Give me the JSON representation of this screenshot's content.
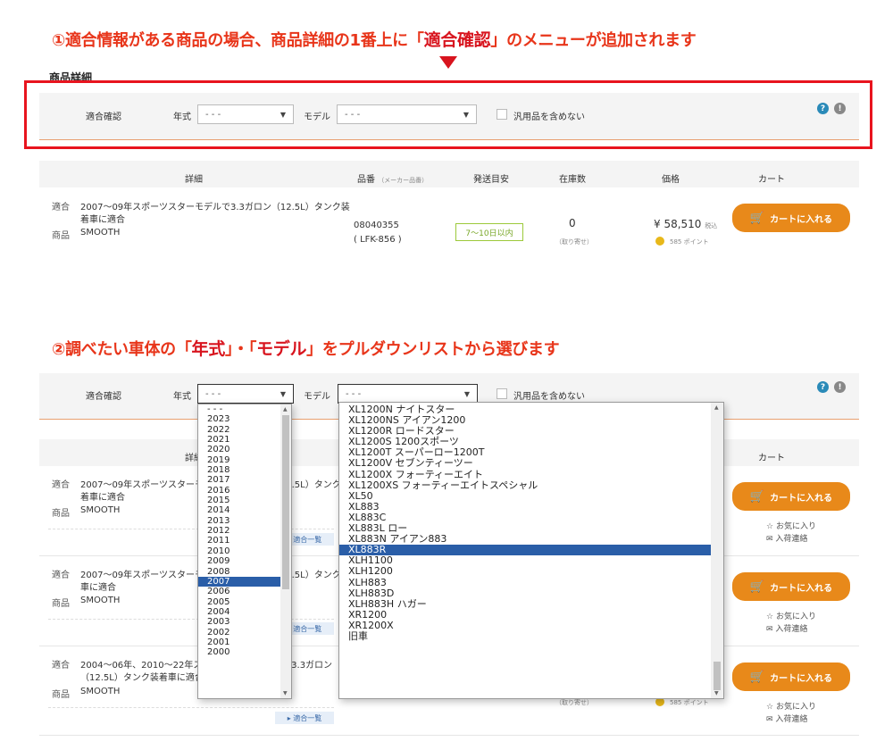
{
  "captions": {
    "step1_prefix": "①適合情報がある商品の場合、商品詳細の1番上に「",
    "step1_highlight": "適合確認",
    "step1_suffix": "」のメニューが追加されます",
    "step2_prefix": "②調べたい車体の「",
    "step2_hl1": "年式",
    "step2_mid": "」・「",
    "step2_hl2": "モデル",
    "step2_suffix": "」をプルダウンリストから選びます"
  },
  "section_title": "商品詳細",
  "filter": {
    "label": "適合確認",
    "year_label": "年式",
    "year_value": "- - -",
    "model_label": "モデル",
    "model_value": "- - -",
    "include_generic": "汎用品を含めない"
  },
  "table": {
    "headers": {
      "detail": "詳細",
      "part_no": "品番",
      "part_no_sub": "（メーカー品番）",
      "ship": "発送目安",
      "stock": "在庫数",
      "price": "価格",
      "cart": "カート"
    }
  },
  "product1": {
    "fit_label": "適合",
    "fit_text_1": "2007〜09年スポーツスターモデルで3.3ガロン（12.5L）タンク装",
    "fit_text_2": "着車に適合",
    "product_label": "商品",
    "product_name": "SMOOTH",
    "part_no": "08040355",
    "maker_no": "( LFK-856 )",
    "ship": "7〜10日以内",
    "stock": "0",
    "stock_sub": "（取り寄せ）",
    "price": "¥ 58,510",
    "tax": "税込",
    "points": "585 ポイント",
    "cart_button": "カートに入れる"
  },
  "rows2": [
    {
      "fit_label": "適合",
      "fit_text_1": "2007〜09年スポーツスターモデルで3.3ガロン（12.5L）タンク装",
      "fit_text_2": "着車に適合",
      "product_label": "商品",
      "product_name": "SMOOTH",
      "fit_link": "▸ 適合一覧"
    },
    {
      "fit_label": "適合",
      "fit_text_1": "2007〜09年スポーツスターモデルで3.3ガロン（12.5L）タンク装着",
      "fit_text_2": "車に適合",
      "product_label": "商品",
      "product_name": "SMOOTH",
      "fit_link": "▸ 適合一覧"
    },
    {
      "fit_label": "適合",
      "fit_text_1": "2004〜06年、2010〜22年スポーツスターモデルで3.3ガロン",
      "fit_text_2": "（12.5L）タンク装着車に適合",
      "product_label": "商品",
      "product_name": "SMOOTH",
      "fit_link": "▸ 適合一覧"
    }
  ],
  "row_actions": {
    "cart_button": "カートに入れる",
    "favorite": "お気に入り",
    "restock": "入荷連絡"
  },
  "partial_texts": {
    "stock_sub": "（取り寄せ）",
    "points": "585 ポイント"
  },
  "year_options": [
    "- - -",
    "2023",
    "2022",
    "2021",
    "2020",
    "2019",
    "2018",
    "2017",
    "2016",
    "2015",
    "2014",
    "2013",
    "2012",
    "2011",
    "2010",
    "2009",
    "2008",
    "2007",
    "2006",
    "2005",
    "2004",
    "2003",
    "2002",
    "2001",
    "2000"
  ],
  "year_selected": "2007",
  "model_options": [
    "XL1200N ナイトスター",
    "XL1200NS アイアン1200",
    "XL1200R ロードスター",
    "XL1200S 1200スポーツ",
    "XL1200T スーパーロー1200T",
    "XL1200V セブンティーツー",
    "XL1200X フォーティーエイト",
    "XL1200XS フォーティーエイトスペシャル",
    "XL50",
    "XL883",
    "XL883C",
    "XL883L ロー",
    "XL883N アイアン883",
    "XL883R",
    "XLH1100",
    "XLH1200",
    "XLH883",
    "XLH883D",
    "XLH883H ハガー",
    "XR1200",
    "XR1200X",
    "旧車"
  ],
  "model_selected": "XL883R",
  "colors": {
    "accent_red": "#d8141e",
    "cart_orange": "#e8891a",
    "select_blue": "#2a5ea8",
    "ship_green": "#9cc93a"
  }
}
